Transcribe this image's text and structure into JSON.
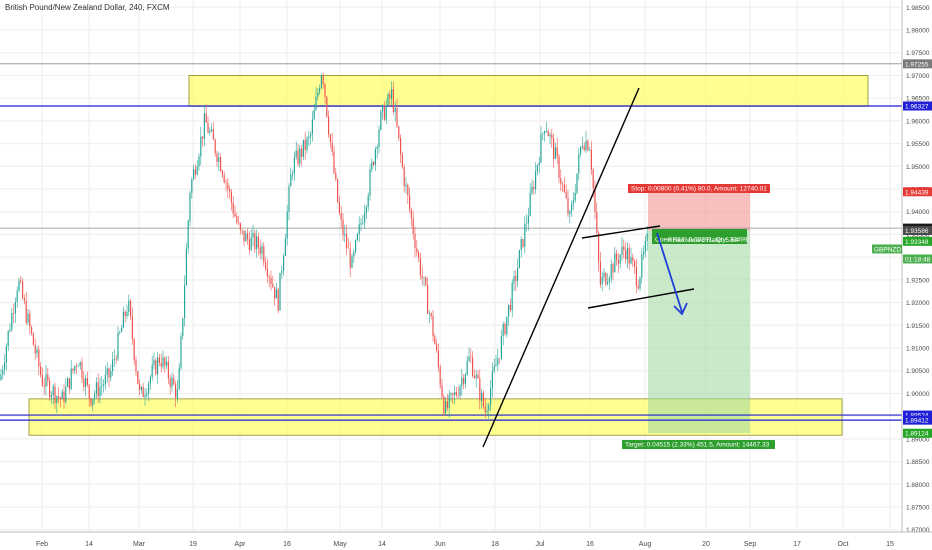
{
  "title": "British Pound/New Zealand Dollar, 240, FXCM",
  "chart_data": {
    "type": "candlestick",
    "symbol": "GBPNZD",
    "ylim": [
      1.8695,
      1.9866
    ],
    "y_ticks": [
      "1.98500",
      "1.98000",
      "1.97500",
      "1.97000",
      "1.96500",
      "1.96000",
      "1.95500",
      "1.95000",
      "1.94500",
      "1.94000",
      "1.93500",
      "1.93000",
      "1.92500",
      "1.92000",
      "1.91500",
      "1.91000",
      "1.90500",
      "1.90000",
      "1.89500",
      "1.89000",
      "1.88500",
      "1.88000",
      "1.87500",
      "1.87000"
    ],
    "x_ticks": [
      "Feb",
      "14",
      "Mar",
      "19",
      "Apr",
      "16",
      "May",
      "14",
      "Jun",
      "18",
      "Jul",
      "16",
      "Aug",
      "20",
      "Sep",
      "17",
      "Oct",
      "15"
    ],
    "price_levels": [
      {
        "value": 1.97255,
        "label": "1.97255",
        "color": "#7a7a7a"
      },
      {
        "value": 1.96327,
        "label": "1.96327",
        "color": "#1f1fd6"
      },
      {
        "value": 1.94439,
        "label": "1.94439",
        "color": "#e53935"
      },
      {
        "value": 1.93639,
        "label": "1.93639",
        "color": "#1a1a1a"
      },
      {
        "value": 1.93586,
        "label": "1.93586",
        "color": "#4a4a4a"
      },
      {
        "value": 1.93348,
        "label": "1.93348",
        "color": "#26a626"
      },
      {
        "value": 1.89524,
        "label": "1.89524",
        "color": "#1f1fd6"
      },
      {
        "value": 1.89412,
        "label": "1.89412",
        "color": "#1f1fd6"
      },
      {
        "value": 1.89124,
        "label": "1.89124",
        "color": "#26a626"
      }
    ],
    "symbol_tag": {
      "label": "GBPNZD",
      "color": "#4caf50"
    },
    "countdown_tag": {
      "label": "01:18:48",
      "color": "#4caf50"
    },
    "zones": [
      {
        "name": "resistance",
        "y_top": 1.97,
        "y_bottom": 1.9632,
        "color": "#ffff66"
      },
      {
        "name": "support",
        "y_top": 1.8988,
        "y_bottom": 1.8908,
        "color": "#ffff66"
      }
    ],
    "stop_label": "Stop: 0.00800 (0.41%) 80.0, Amount: 12740.01",
    "pnl_label": "Open P&L: 0.00291, Qty: 32499",
    "rr_label": "Risk/Reward Ratio: 5.64",
    "target_label": "Target: 0.04515 (2.33%) 451.5, Amount: 14467.33",
    "colors": {
      "up": "#26a69a",
      "down": "#ef5350",
      "grid": "#eeeeee"
    }
  }
}
